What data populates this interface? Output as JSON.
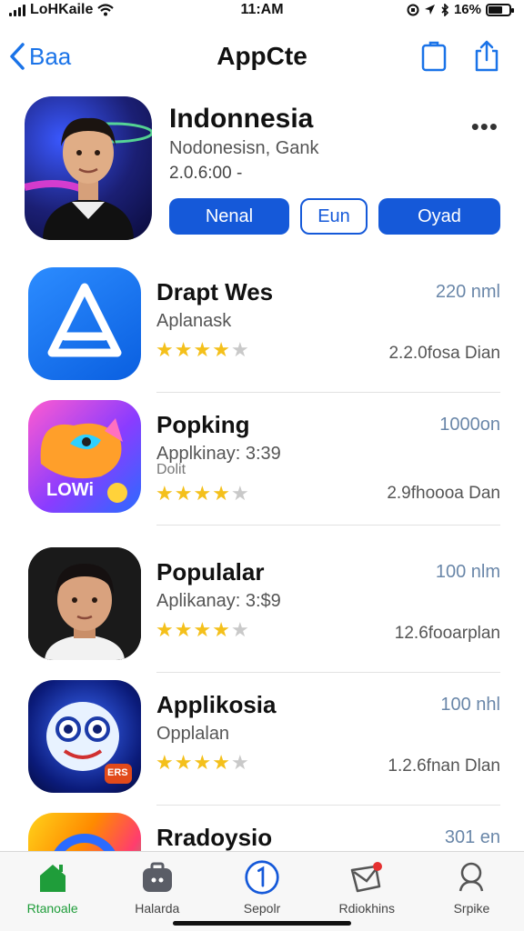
{
  "status_bar": {
    "carrier": "LoHKaile",
    "time": "11:AM",
    "battery": "16%"
  },
  "nav": {
    "back_label": "Baa",
    "title": "AppCte"
  },
  "featured": {
    "title": "Indonnesia",
    "subtitle": "Nodonesisn, Gank",
    "meta": "2.0.6:00 -",
    "buttons": [
      "Nenal",
      "Eun",
      "Oyad"
    ]
  },
  "apps": [
    {
      "name": "Drapt Wes",
      "category": "Aplanask",
      "category2": "",
      "rating": 4,
      "size": "220 nml",
      "downloads": "2.2.0fosa Dian"
    },
    {
      "name": "Popking",
      "category": "Applkinay: 3:39",
      "category2": "Dolit",
      "rating": 4,
      "size": "1000on",
      "downloads": "2.9fhoooa Dan"
    },
    {
      "name": "Populalar",
      "category": "Aplikanay: 3:$9",
      "category2": "",
      "rating": 4,
      "size": "100 nlm",
      "downloads": "12.6fooarplan"
    },
    {
      "name": "Applikosia",
      "category": "Opplalan",
      "category2": "",
      "rating": 4,
      "size": "100 nhl",
      "downloads": "1.2.6fnan Dlan"
    },
    {
      "name": "Rradoysio",
      "category": "",
      "category2": "",
      "rating": 0,
      "size": "301 en",
      "downloads": ""
    }
  ],
  "icon_badges": {
    "popking": "LOWi",
    "applikosia": "ERS"
  },
  "tabs": [
    {
      "label": "Rtanoale",
      "icon": "home-icon",
      "active": true
    },
    {
      "label": "Halarda",
      "icon": "gamepad-icon",
      "active": false
    },
    {
      "label": "Sepolr",
      "icon": "update-icon",
      "active": false
    },
    {
      "label": "Rdiokhins",
      "icon": "notifications-icon",
      "active": false
    },
    {
      "label": "Srpike",
      "icon": "search-icon",
      "active": false
    }
  ],
  "colors": {
    "accent": "#1559d9",
    "tab_active": "#1f9d3a",
    "star": "#f4c01b"
  }
}
